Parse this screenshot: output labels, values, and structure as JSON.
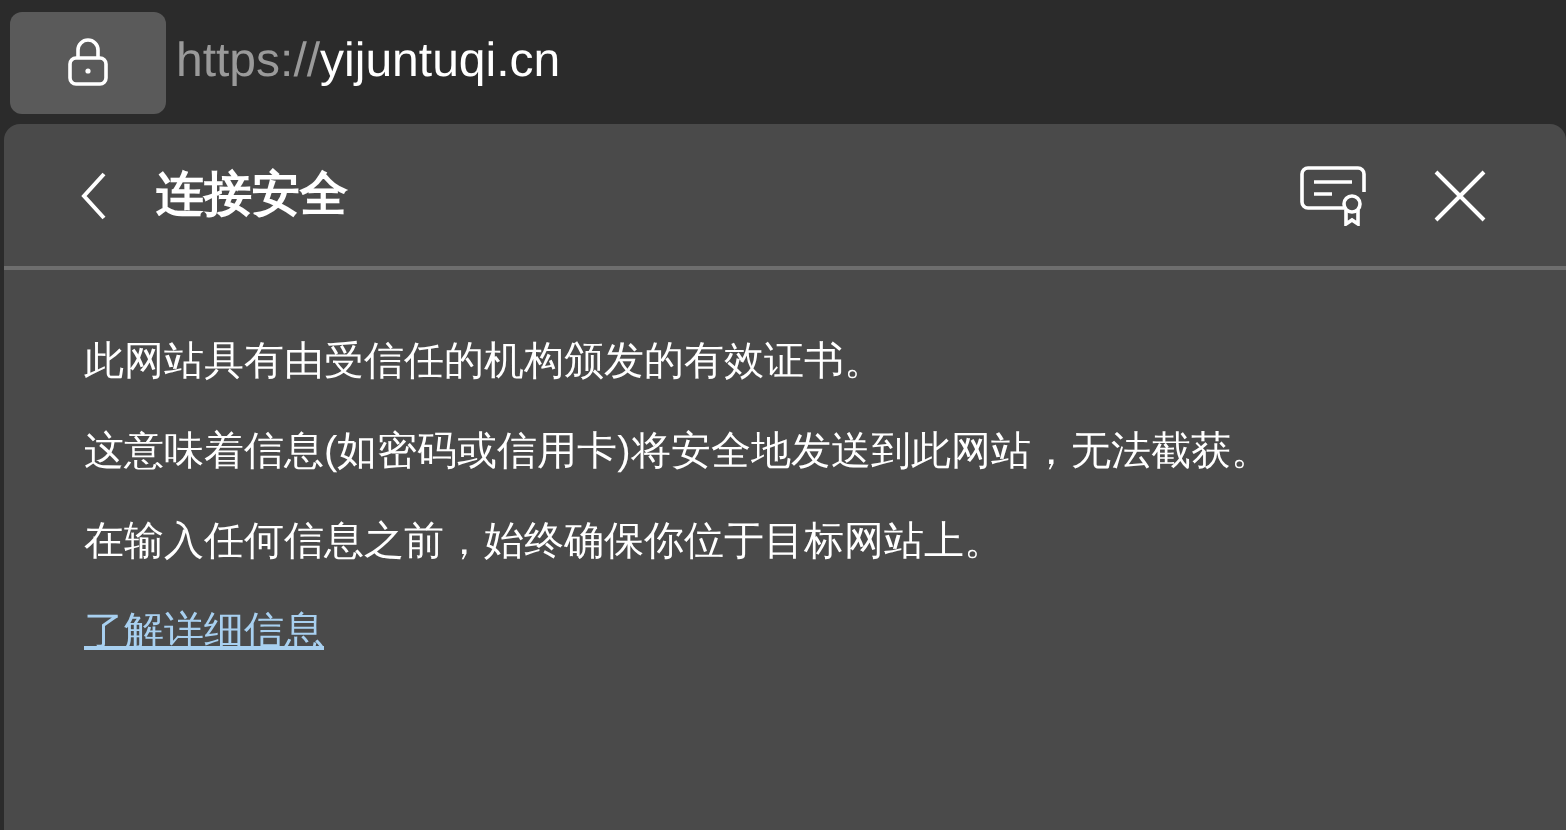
{
  "address_bar": {
    "scheme": "https://",
    "host": "yijuntuqi.cn"
  },
  "panel": {
    "title": "连接安全",
    "paragraphs": [
      "此网站具有由受信任的机构颁发的有效证书。",
      "这意味着信息(如密码或信用卡)将安全地发送到此网站，无法截获。",
      "在输入任何信息之前，始终确保你位于目标网站上。"
    ],
    "link": "了解详细信息"
  }
}
